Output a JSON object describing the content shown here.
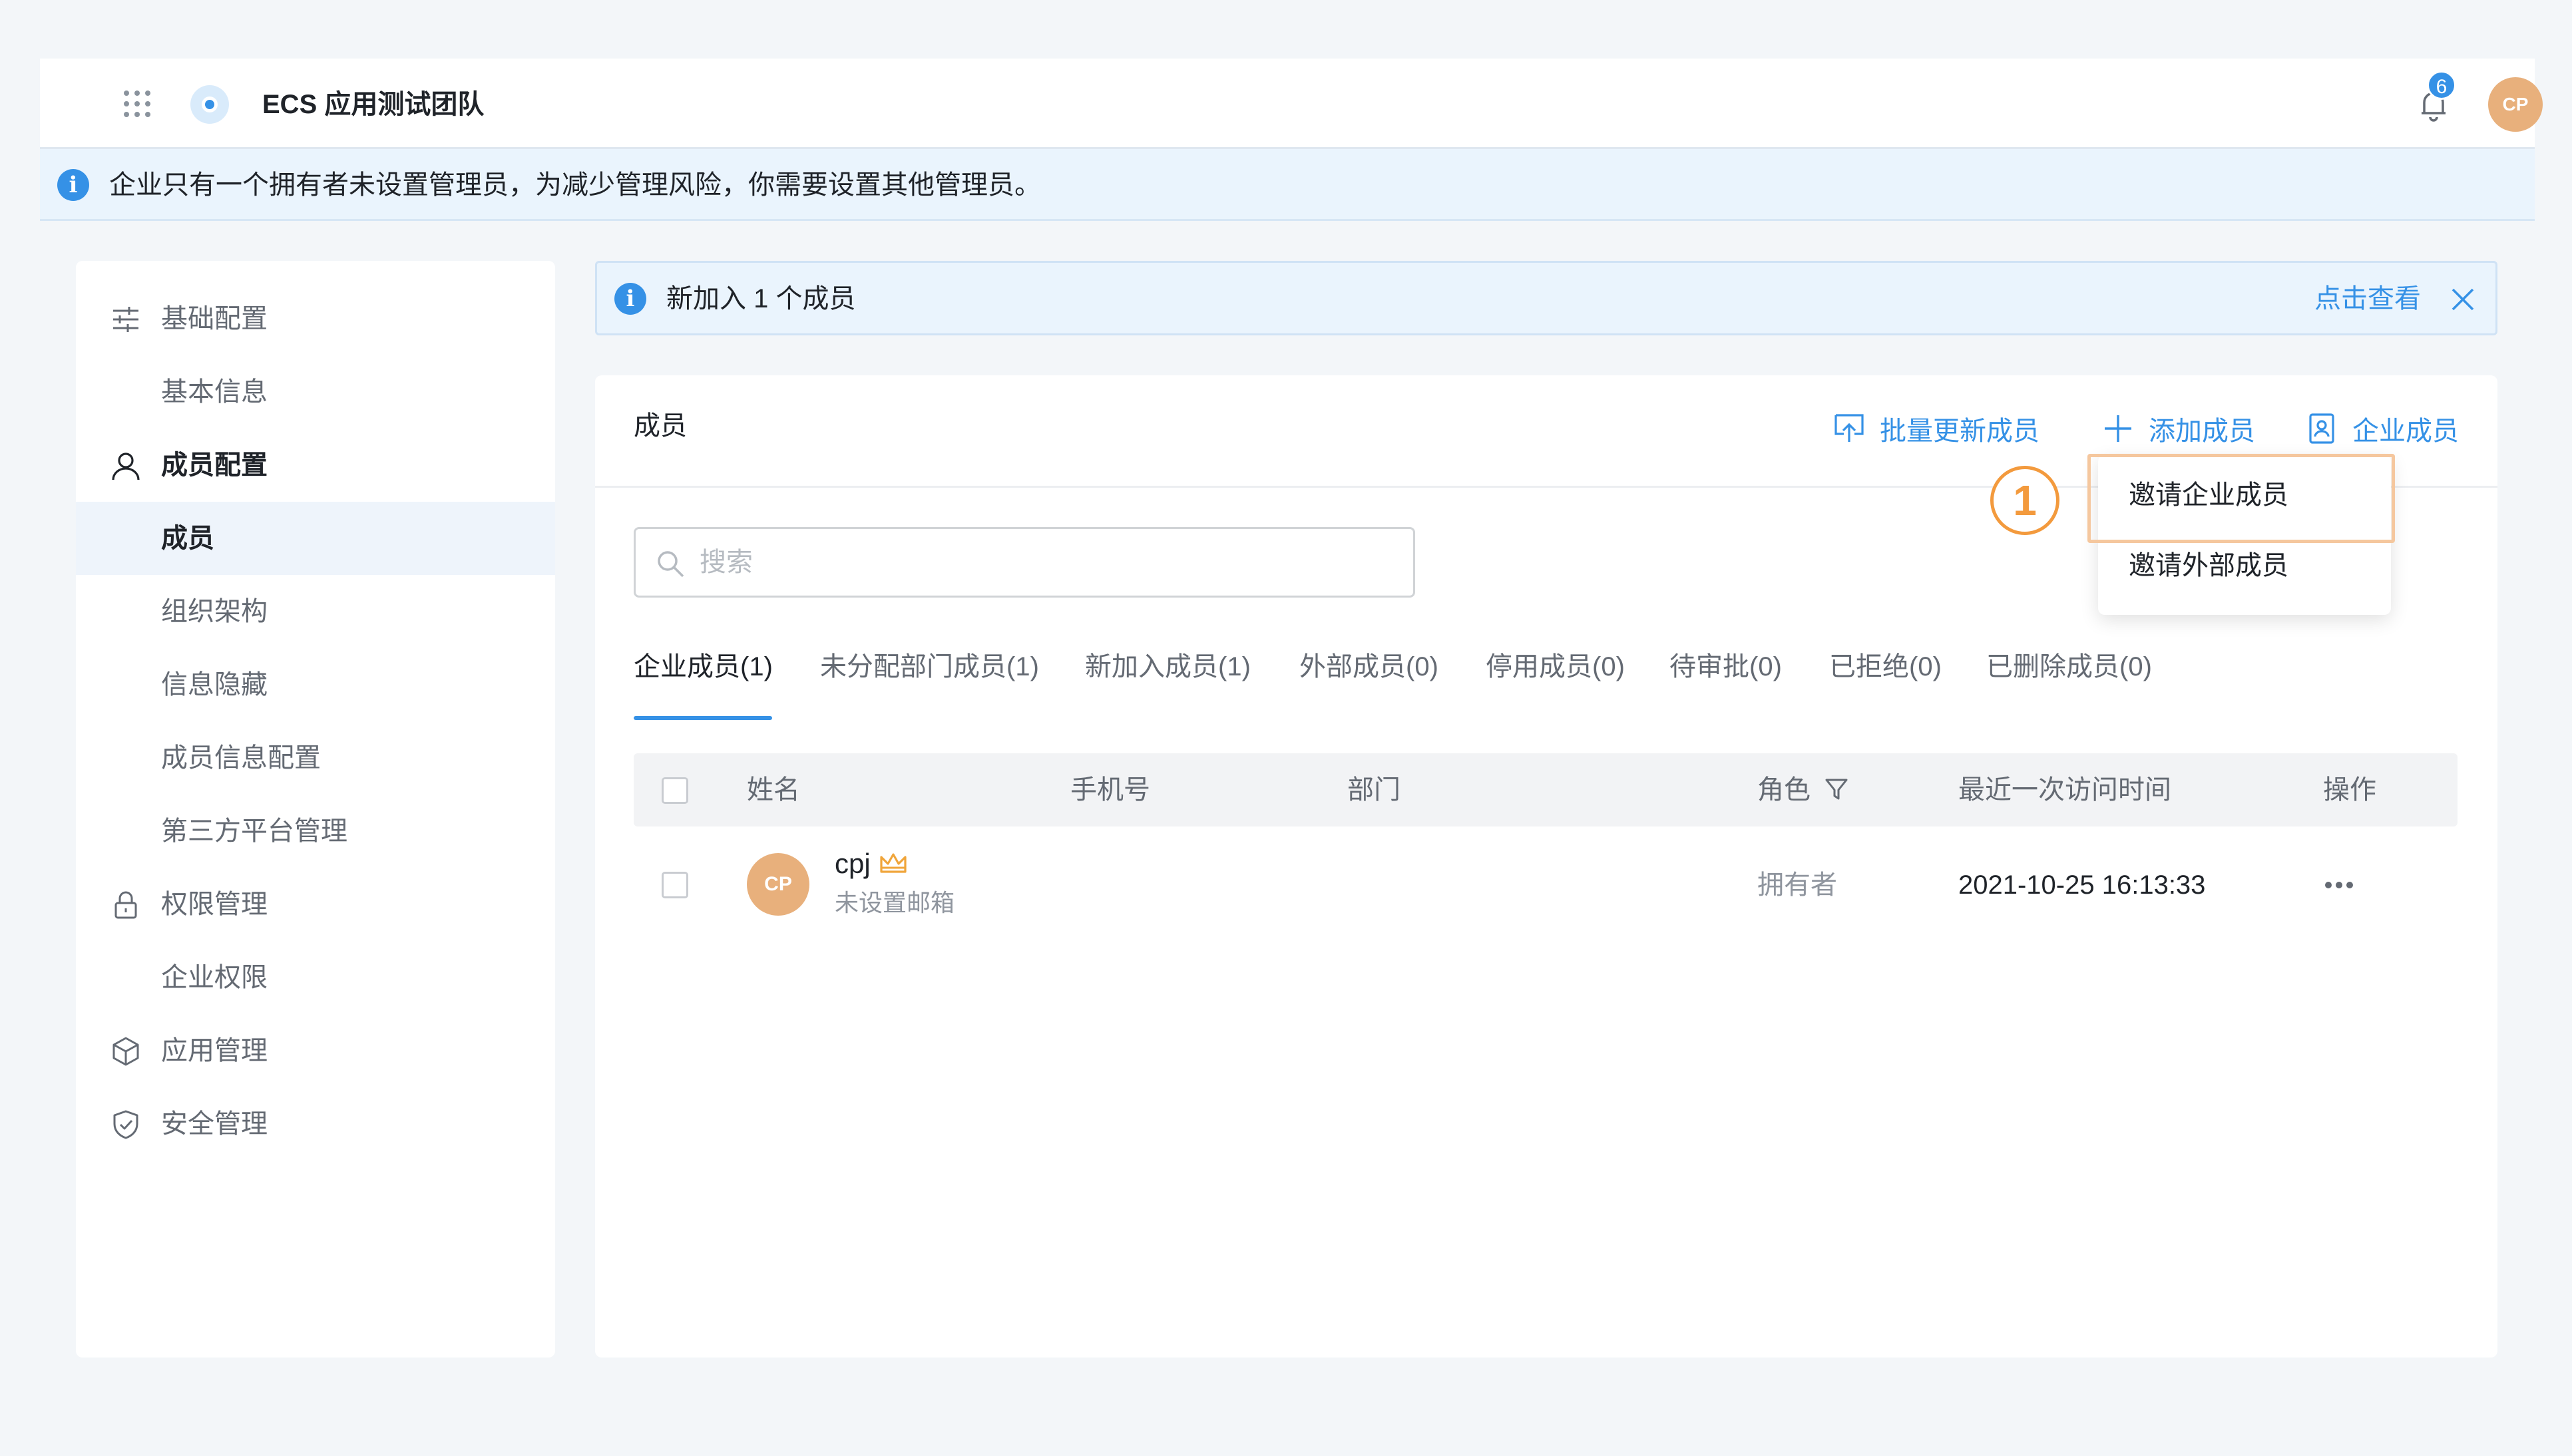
{
  "header": {
    "team_name": "ECS 应用测试团队",
    "notification_count": "6",
    "user_avatar": "CP"
  },
  "warning_banner": {
    "text": "企业只有一个拥有者未设置管理员，为减少管理风险，你需要设置其他管理员。"
  },
  "sidebar": {
    "items": [
      {
        "label": "基础配置",
        "icon": "sliders-icon",
        "type": "group"
      },
      {
        "label": "基本信息",
        "type": "sub"
      },
      {
        "label": "成员配置",
        "icon": "user-icon",
        "type": "group"
      },
      {
        "label": "成员",
        "type": "sub",
        "active": true
      },
      {
        "label": "组织架构",
        "type": "sub"
      },
      {
        "label": "信息隐藏",
        "type": "sub"
      },
      {
        "label": "成员信息配置",
        "type": "sub"
      },
      {
        "label": "第三方平台管理",
        "type": "sub"
      },
      {
        "label": "权限管理",
        "icon": "lock-icon",
        "type": "group"
      },
      {
        "label": "企业权限",
        "type": "sub"
      },
      {
        "label": "应用管理",
        "icon": "cube-icon",
        "type": "group"
      },
      {
        "label": "安全管理",
        "icon": "shield-icon",
        "type": "group"
      }
    ]
  },
  "notice": {
    "text": "新加入 1 个成员",
    "link": "点击查看"
  },
  "members": {
    "title": "成员",
    "actions": {
      "bulk_update": "批量更新成员",
      "add_member": "添加成员",
      "enterprise_member": "企业成员"
    },
    "search_placeholder": "搜索",
    "tabs": [
      "企业成员(1)",
      "未分配部门成员(1)",
      "新加入成员(1)",
      "外部成员(0)",
      "停用成员(0)",
      "待审批(0)",
      "已拒绝(0)",
      "已删除成员(0)"
    ],
    "columns": {
      "name": "姓名",
      "phone": "手机号",
      "department": "部门",
      "role": "角色",
      "last_visit": "最近一次访问时间",
      "operation": "操作"
    },
    "rows": [
      {
        "avatar": "CP",
        "name": "cpj",
        "email": "未设置邮箱",
        "phone": "",
        "department": "",
        "role": "拥有者",
        "last_visit": "2021-10-25 16:13:33"
      }
    ]
  },
  "dropdown": {
    "items": [
      "邀请企业成员",
      "邀请外部成员"
    ]
  },
  "annotation": {
    "step": "1"
  },
  "colors": {
    "accent": "#3591e6",
    "avatar": "#e8b07c",
    "annotation": "#f39a3d"
  }
}
